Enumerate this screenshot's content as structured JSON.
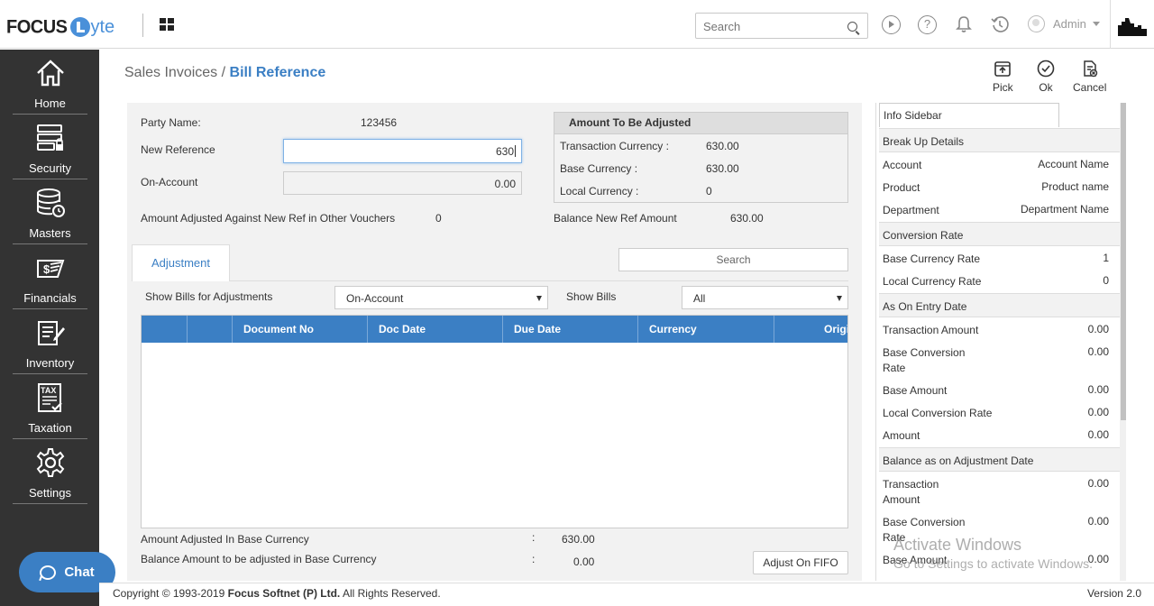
{
  "header": {
    "logo_focus": "FOCUS",
    "logo_lyte": "yte",
    "search_placeholder": "Search",
    "user": "Admin"
  },
  "sidebar": {
    "items": [
      {
        "label": "Home",
        "icon": "home-icon"
      },
      {
        "label": "Security",
        "icon": "security-icon"
      },
      {
        "label": "Masters",
        "icon": "masters-icon"
      },
      {
        "label": "Financials",
        "icon": "financials-icon"
      },
      {
        "label": "Inventory",
        "icon": "inventory-icon"
      },
      {
        "label": "Taxation",
        "icon": "taxation-icon"
      },
      {
        "label": "Settings",
        "icon": "gear-icon"
      }
    ],
    "chat_label": "Chat"
  },
  "breadcrumb": {
    "parent": "Sales Invoices",
    "sep": "/",
    "current": "Bill Reference"
  },
  "toolbar": {
    "pick": "Pick",
    "ok": "Ok",
    "cancel": "Cancel"
  },
  "form": {
    "party_label": "Party Name:",
    "party_value": "123456",
    "new_ref_label": "New Reference",
    "new_ref_value": "630",
    "on_account_label": "On-Account",
    "on_account_value": "0.00",
    "adjusted_other_label": "Amount Adjusted Against New Ref in Other Vouchers",
    "adjusted_other_value": "0",
    "balance_new_ref_label": "Balance New Ref Amount",
    "balance_new_ref_value": "630.00"
  },
  "adjust_box": {
    "title": "Amount To Be Adjusted",
    "rows": [
      {
        "label": "Transaction Currency :",
        "value": "630.00"
      },
      {
        "label": "Base Currency :",
        "value": "630.00"
      },
      {
        "label": "Local Currency :",
        "value": "0"
      }
    ]
  },
  "tabs": {
    "adjustment": "Adjustment",
    "search_placeholder": "Search"
  },
  "filters": {
    "show_bills_for_label": "Show Bills for Adjustments",
    "show_bills_for_value": "On-Account",
    "show_bills_label": "Show Bills",
    "show_bills_value": "All"
  },
  "grid": {
    "columns": [
      "",
      "",
      "Document No",
      "Doc Date",
      "Due Date",
      "Currency",
      "Original"
    ]
  },
  "footer_summary": {
    "adjusted_base_label": "Amount Adjusted In Base Currency",
    "adjusted_base_value": "630.00",
    "balance_base_label": "Balance Amount to be adjusted in Base Currency",
    "balance_base_value": "0.00",
    "colon": ":",
    "fifo_button": "Adjust On FIFO"
  },
  "info_sidebar": {
    "title": "Info Sidebar",
    "breakup": {
      "header": "Break Up Details",
      "rows": [
        {
          "k": "Account",
          "v": "Account Name"
        },
        {
          "k": "Product",
          "v": "Product name"
        },
        {
          "k": "Department",
          "v": "Department Name"
        }
      ]
    },
    "conversion": {
      "header": "Conversion Rate",
      "rows": [
        {
          "k": "Base Currency Rate",
          "v": "1"
        },
        {
          "k": "Local Currency Rate",
          "v": "0"
        }
      ]
    },
    "entry_date": {
      "header": "As On Entry Date",
      "rows": [
        {
          "k": "Transaction Amount",
          "v": "0.00"
        },
        {
          "k": "Base Conversion Rate",
          "v": "0.00"
        },
        {
          "k": "Base Amount",
          "v": "0.00"
        },
        {
          "k": "Local Conversion Rate",
          "v": "0.00"
        },
        {
          "k": "Amount",
          "v": "0.00"
        }
      ]
    },
    "adjustment_date": {
      "header": "Balance as on Adjustment Date",
      "rows": [
        {
          "k": "Transaction Amount",
          "v": "0.00"
        },
        {
          "k": "Base Conversion Rate",
          "v": "0.00"
        },
        {
          "k": "Base Amount",
          "v": "0.00"
        }
      ]
    }
  },
  "watermark": {
    "line1": "Activate Windows",
    "line2": "Go to Settings to activate Windows."
  },
  "footer": {
    "copyright_prefix": "Copyright © 1993-2019",
    "company": "Focus Softnet (P) Ltd.",
    "rights": "All Rights Reserved.",
    "version": "Version 2.0"
  },
  "colors": {
    "accent": "#3b7fc4",
    "sidebar_bg": "#333333",
    "panel_bg": "#f2f2f2"
  }
}
